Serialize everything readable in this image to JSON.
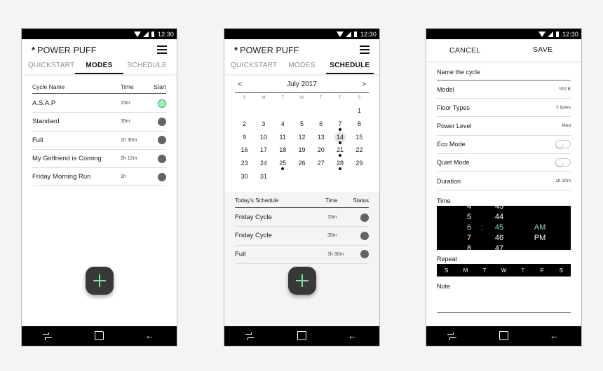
{
  "app": {
    "brand": "POWER PUFF",
    "brand_icon": "asterisk-star-icon"
  },
  "status_bar": {
    "time": "12:30",
    "icons": [
      "wifi-icon",
      "signal-icon",
      "battery-icon"
    ]
  },
  "tabs": [
    "QUICKSTART",
    "MODES",
    "SCHEDULE"
  ],
  "screens": {
    "modes": {
      "active_tab": "MODES",
      "headers": {
        "name": "Cycle Name",
        "time": "Time",
        "start": "Start"
      },
      "rows": [
        {
          "name": "A.S.A.P",
          "time": "15m",
          "active": true
        },
        {
          "name": "Standard",
          "time": "35m",
          "active": false
        },
        {
          "name": "Full",
          "time": "1h 30m",
          "active": false
        },
        {
          "name": "My Girlfriend is Coming",
          "time": "2h 12m",
          "active": false
        },
        {
          "name": "Friday Morning Run",
          "time": "1h",
          "active": false
        }
      ],
      "fab_icon": "plus-icon"
    },
    "schedule": {
      "active_tab": "SCHEDULE",
      "calendar": {
        "month_label": "July 2017",
        "prev_icon": "<",
        "next_icon": ">",
        "weekdays": [
          "S",
          "M",
          "T",
          "W",
          "T",
          "F",
          "S"
        ],
        "first_weekday_index": 6,
        "days_in_month": 31,
        "selected_day": 14,
        "event_days": [
          7,
          14,
          21,
          25,
          28
        ]
      },
      "headers": {
        "name": "Today's Schedule",
        "time": "Time",
        "status": "Status"
      },
      "rows": [
        {
          "name": "Friday Cycle",
          "time": "15m"
        },
        {
          "name": "Friday Cycle",
          "time": "35m"
        },
        {
          "name": "Full",
          "time": "1h 30m"
        }
      ],
      "fab_icon": "plus-icon"
    },
    "edit": {
      "cancel_label": "CANCEL",
      "save_label": "SAVE",
      "name_placeholder": "Name the cycle",
      "fields": [
        {
          "label": "Model",
          "value": "*PP B",
          "type": "value"
        },
        {
          "label": "Floor Types",
          "value": "3 types",
          "type": "value"
        },
        {
          "label": "Power Level",
          "value": "Med",
          "type": "value"
        },
        {
          "label": "Eco Mode",
          "value": false,
          "type": "toggle"
        },
        {
          "label": "Quiet Mode",
          "value": false,
          "type": "toggle"
        },
        {
          "label": "Duration",
          "value": "1h 30m",
          "type": "value"
        }
      ],
      "time_label": "Time",
      "time_picker": {
        "hours": [
          "4",
          "5",
          "6",
          "7",
          "8"
        ],
        "minutes": [
          "43",
          "44",
          "45",
          "46",
          "47"
        ],
        "separator": ":",
        "ampm": [
          "AM",
          "PM"
        ],
        "selected": {
          "hour": "6",
          "minute": "45",
          "ampm": "AM"
        }
      },
      "repeat_label": "Repeat",
      "repeat_days": [
        {
          "label": "S",
          "on": false
        },
        {
          "label": "M",
          "on": false
        },
        {
          "label": "T",
          "on": false
        },
        {
          "label": "W",
          "on": false
        },
        {
          "label": "T",
          "on": true
        },
        {
          "label": "F",
          "on": false
        },
        {
          "label": "S",
          "on": false
        }
      ],
      "note_label": "Note"
    }
  },
  "nav_bar": {
    "icons": [
      "recent-apps-icon",
      "home-icon",
      "back-icon"
    ],
    "back_glyph": "←"
  },
  "colors": {
    "accent_green": "#8ee0a6",
    "active_dot": "#9df2b4",
    "inactive_dot": "#646464",
    "fab": "#383838"
  }
}
